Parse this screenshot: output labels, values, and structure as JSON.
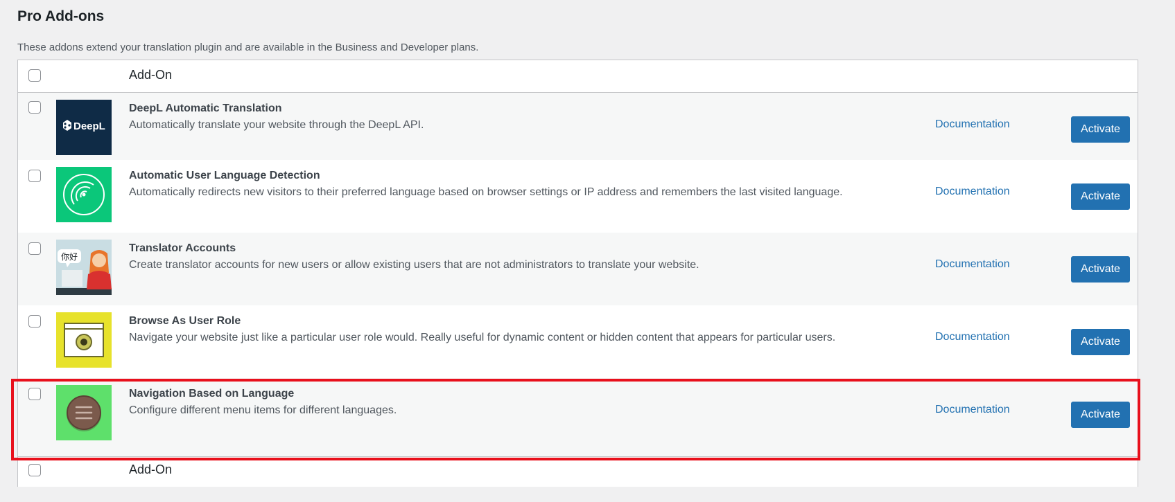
{
  "page": {
    "title": "Pro Add-ons",
    "description": "These addons extend your translation plugin and are available in the Business and Developer plans."
  },
  "table": {
    "header_label": "Add-On",
    "footer_label": "Add-On"
  },
  "addons": [
    {
      "name": "DeepL Automatic Translation",
      "description": "Automatically translate your website through the DeepL API.",
      "doc_label": "Documentation",
      "action_label": "Activate",
      "icon": "deepl-logo-icon",
      "logo_text": "DeepL",
      "bg_color": "#0f2b46"
    },
    {
      "name": "Automatic User Language Detection",
      "description": "Automatically redirects new visitors to their preferred language based on browser settings or IP address and remembers the last visited language.",
      "doc_label": "Documentation",
      "action_label": "Activate",
      "icon": "radar-icon",
      "bg_color": "#0bc77a"
    },
    {
      "name": "Translator Accounts",
      "description": "Create translator accounts for new users or allow existing users that are not administrators to translate your website.",
      "doc_label": "Documentation",
      "action_label": "Activate",
      "icon": "translator-illustration-icon",
      "bubble_text": "你好",
      "bg_color": "#c9dde3"
    },
    {
      "name": "Browse As User Role",
      "description": "Navigate your website just like a particular user role would. Really useful for dynamic content or hidden content that appears for particular users.",
      "doc_label": "Documentation",
      "action_label": "Activate",
      "icon": "eye-window-icon",
      "bg_color": "#e7e22b"
    },
    {
      "name": "Navigation Based on Language",
      "description": "Configure different menu items for different languages.",
      "doc_label": "Documentation",
      "action_label": "Activate",
      "icon": "menu-icon",
      "bg_color": "#5ee06b"
    }
  ],
  "colors": {
    "accent": "#2271b1",
    "highlight": "#e8101c"
  }
}
